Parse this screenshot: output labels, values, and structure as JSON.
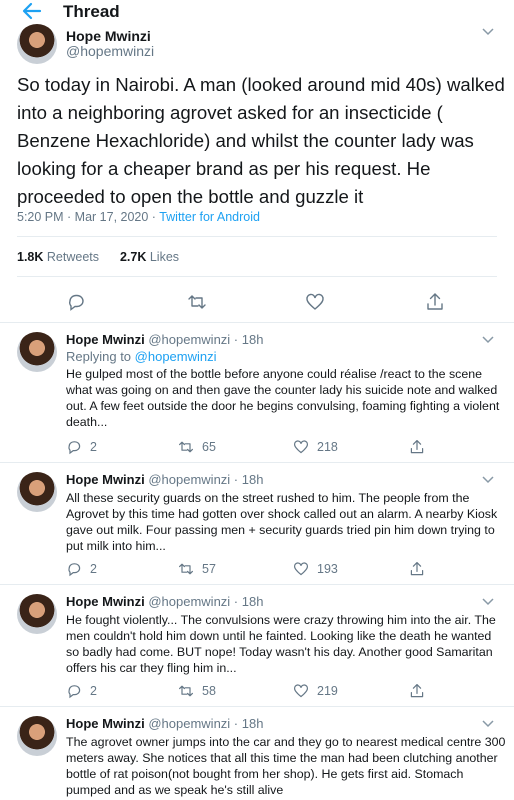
{
  "header": {
    "title": "Thread"
  },
  "main_tweet": {
    "name": "Hope Mwinzi",
    "handle": "@hopemwinzi",
    "text": "So today in Nairobi. A man (looked around mid 40s) walked into a neighboring agrovet asked for an insecticide ( Benzene Hexachloride) and whilst the counter lady was looking for a cheaper brand as per his request. He proceeded to open the bottle and guzzle it",
    "time": "5:20 PM · Mar 17, 2020 · ",
    "source": "Twitter for Android",
    "retweets_count": "1.8K",
    "retweets_label": "Retweets",
    "likes_count": "2.7K",
    "likes_label": "Likes"
  },
  "replies": [
    {
      "name": "Hope Mwinzi",
      "handle": "@hopemwinzi · 18h",
      "replying_prefix": "Replying to ",
      "replying_to": "@hopemwinzi",
      "text": "He gulped most of the bottle before anyone could réalise /react to the scene what was going on and then gave the counter lady his suicide note and walked out. A few feet outside the door he begins convulsing, foaming fighting a violent death...",
      "replies": "2",
      "retweets": "65",
      "likes": "218"
    },
    {
      "name": "Hope Mwinzi",
      "handle": "@hopemwinzi · 18h",
      "text": "All these security guards on the street rushed to him. The people from the Agrovet by this time had gotten over shock called out an alarm. A nearby Kiosk gave out milk. Four passing men + security guards  tried pin him down trying to put milk into him...",
      "replies": "2",
      "retweets": "57",
      "likes": "193"
    },
    {
      "name": "Hope Mwinzi",
      "handle": "@hopemwinzi · 18h",
      "text": "He fought violently... The convulsions were crazy throwing him into the air. The men couldn't hold him down until he fainted. Looking like the death he wanted so badly had come. BUT nope! Today wasn't his day. Another  good Samaritan offers his car they fling him in...",
      "replies": "2",
      "retweets": "58",
      "likes": "219"
    },
    {
      "name": "Hope Mwinzi",
      "handle": "@hopemwinzi · 18h",
      "text": "The agrovet owner jumps into the car and they go to nearest medical centre 300 meters away. She notices that all this time the man had been clutching another bottle of rat poison(not bought from her shop). He gets first aid. Stomach pumped and as we speak he's still alive"
    }
  ],
  "colors": {
    "accent": "#1da1f2",
    "secondary_text": "#657786",
    "divider": "#e6ecf0"
  },
  "icons": [
    "back-arrow-icon",
    "chevron-down-icon",
    "reply-icon",
    "retweet-icon",
    "like-icon",
    "share-icon"
  ]
}
